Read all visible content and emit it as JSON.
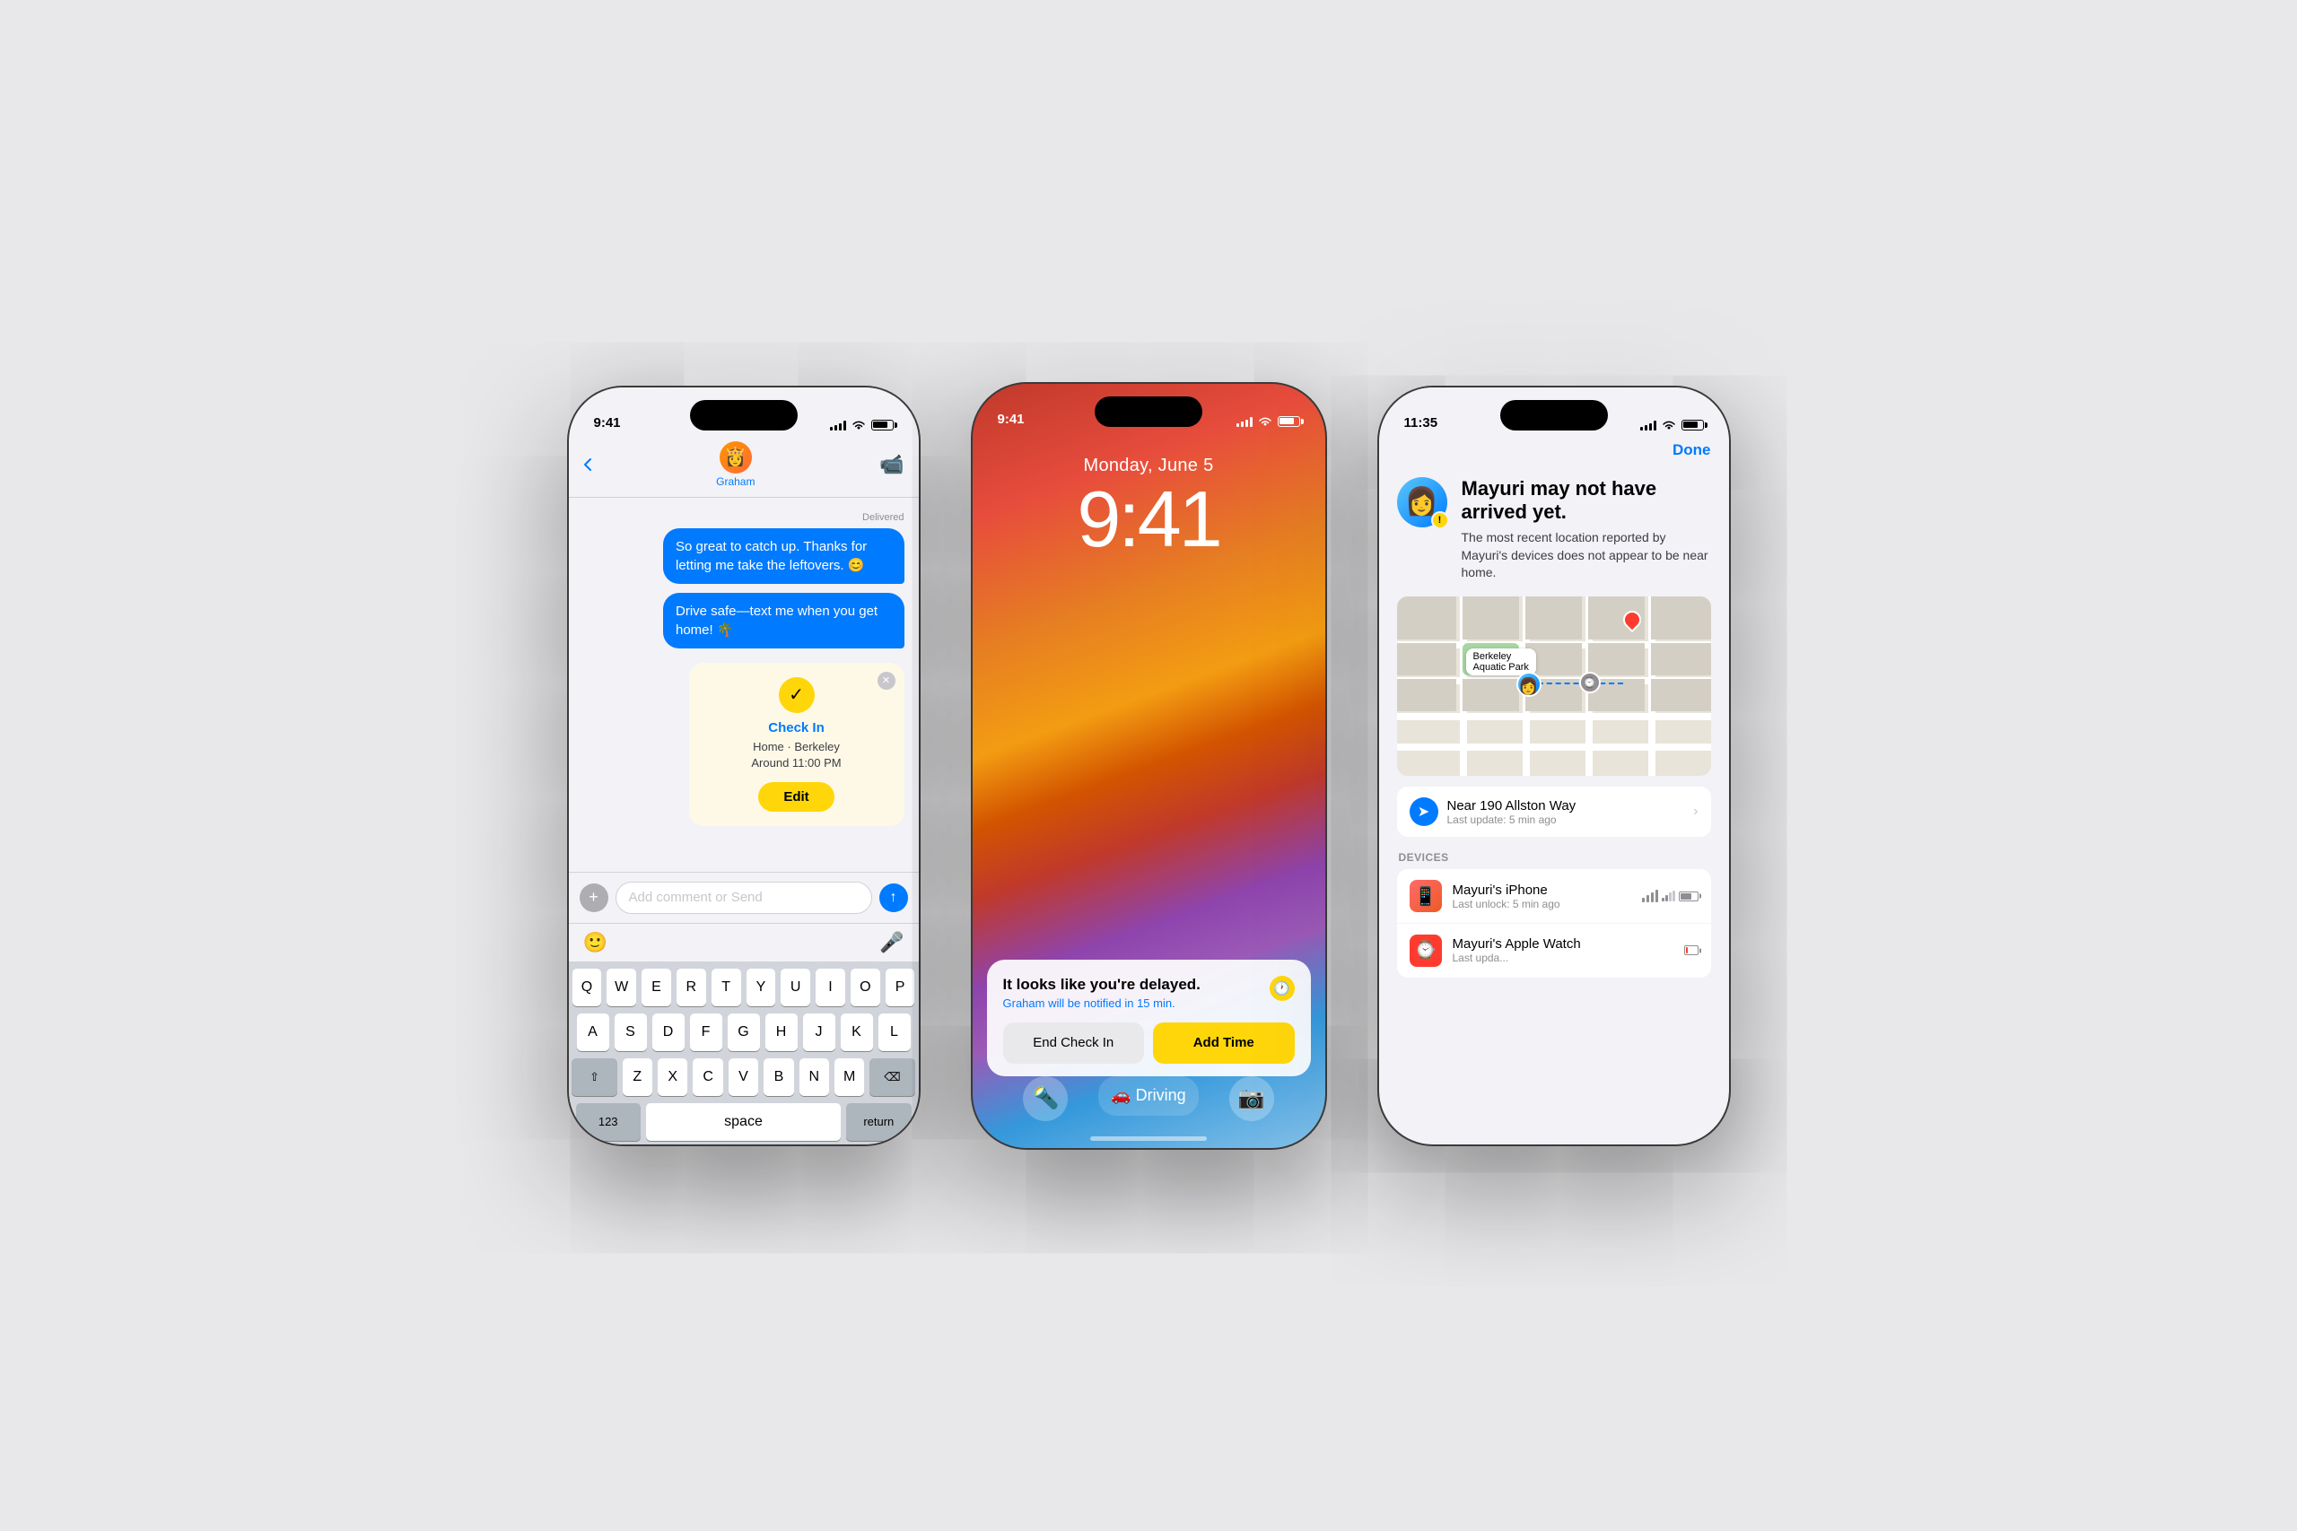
{
  "phone1": {
    "status_time": "9:41",
    "contact_name": "Graham",
    "contact_emoji": "👸",
    "delivered_label": "Delivered",
    "messages": [
      {
        "text": "So great to catch up. Thanks for letting me take the leftovers. 😊",
        "type": "outgoing"
      },
      {
        "text": "Drive safe—text me when you get home! 🌴",
        "type": "outgoing"
      }
    ],
    "check_in_card": {
      "title": "Check In",
      "details_line1": "Home · Berkeley",
      "details_line2": "Around 11:00 PM",
      "edit_label": "Edit"
    },
    "input_placeholder": "Add comment or Send",
    "keyboard_rows": [
      [
        "Q",
        "W",
        "E",
        "R",
        "T",
        "Y",
        "U",
        "I",
        "O",
        "P"
      ],
      [
        "A",
        "S",
        "D",
        "F",
        "G",
        "H",
        "J",
        "K",
        "L"
      ],
      [
        "⇧",
        "Z",
        "X",
        "C",
        "V",
        "B",
        "N",
        "M",
        "⌫"
      ],
      [
        "123",
        "space",
        "return"
      ]
    ]
  },
  "phone2": {
    "status_time": "9:41",
    "date_label": "Monday, June 5",
    "time_label": "9:41",
    "sheet": {
      "title": "It looks like you're delayed.",
      "subtitle": "Graham will be notified in 15 min.",
      "end_check_in": "End Check In",
      "add_time": "Add Time"
    },
    "dock": [
      "🔦",
      "🚗",
      "📷"
    ]
  },
  "phone3": {
    "status_time": "11:35",
    "done_label": "Done",
    "title": "Mayuri may not have arrived yet.",
    "subtitle": "The most recent location reported by Mayuri's devices does not appear to be near home.",
    "avatar_emoji": "👩",
    "warning_badge": "!",
    "location": {
      "name": "Near 190 Allston Way",
      "time": "Last update: 5 min ago"
    },
    "devices_label": "DEVICES",
    "devices": [
      {
        "name": "Mayuri's iPhone",
        "time": "Last unlock: 5 min ago",
        "battery_pct": 70,
        "type": "iphone"
      },
      {
        "name": "Mayuri's Apple Watch",
        "time": "Last upda...",
        "battery_pct": 15,
        "type": "watch"
      }
    ]
  }
}
